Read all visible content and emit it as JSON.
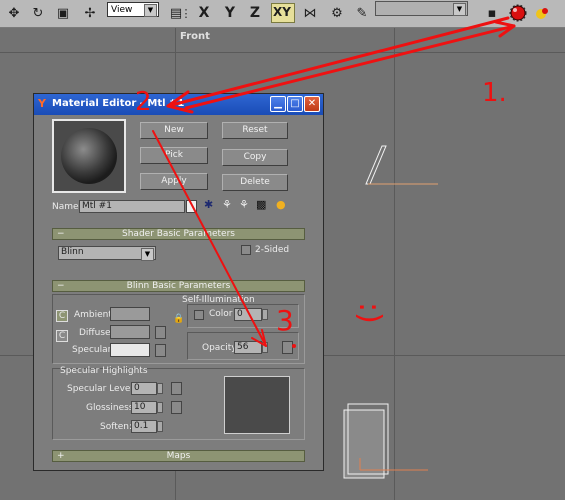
{
  "toolbar": {
    "view_dropdown": "View",
    "axis_x": "X",
    "axis_y": "Y",
    "axis_z": "Z",
    "axis_xy": "XY"
  },
  "viewport": {
    "label": "Front"
  },
  "material_editor": {
    "title": "Material Editor - Mtl #1",
    "buttons": {
      "new": "New",
      "reset": "Reset",
      "pick": "Pick",
      "copy": "Copy",
      "apply": "Apply",
      "delete": "Delete"
    },
    "name_label": "Name",
    "name_value": "Mtl #1",
    "shader_rollout": {
      "title": "Shader Basic Parameters",
      "toggle": "−",
      "shader_type": "Blinn",
      "two_sided_label": "2-Sided"
    },
    "blinn_rollout": {
      "title": "Blinn Basic Parameters",
      "toggle": "−",
      "lock_c1": "C",
      "lock_c2": "C",
      "ambient_label": "Ambient:",
      "diffuse_label": "Diffuse:",
      "specular_label": "Specular:",
      "self_illum_label": "Self-Illumination",
      "color_label": "Color",
      "self_illum_value": "0",
      "opacity_label": "Opacity:",
      "opacity_value": "56"
    },
    "spec_highlights": {
      "title": "Specular Highlights",
      "specular_level_label": "Specular Level:",
      "specular_level_value": "0",
      "glossiness_label": "Glossiness:",
      "glossiness_value": "10",
      "soften_label": "Soften:",
      "soften_value": "0.1"
    },
    "maps_rollout": {
      "title": "Maps",
      "toggle": "+"
    }
  },
  "annotations": {
    "step1": "1.",
    "step2": "2",
    "step3": "3",
    "smiley": ":)"
  },
  "colors": {
    "toolbar_bg": "#b9b9b9",
    "viewport_bg": "#727272",
    "title_blue": "#1a4cb6",
    "rollout_green": "#8d9473",
    "annotation_red": "#ee1111"
  }
}
